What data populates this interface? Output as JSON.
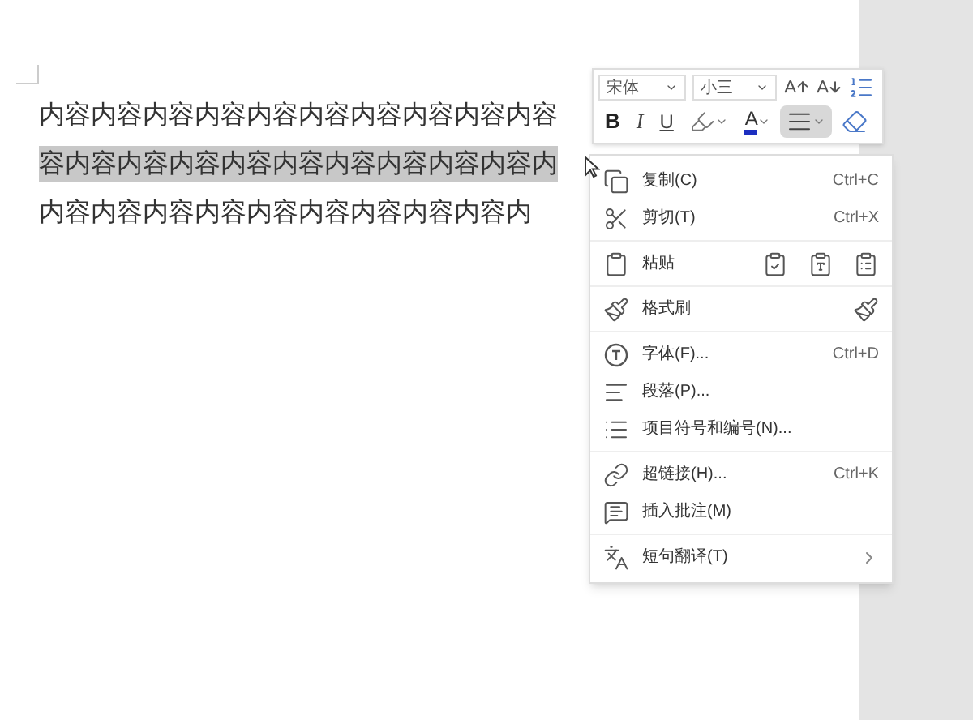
{
  "document": {
    "lines": [
      {
        "text": "内容内容内容内容内容内容内容内容内容内容",
        "selected": false
      },
      {
        "text": "容内容内容内容内容内容内容内容内容内容内",
        "selected": true
      },
      {
        "text": "内容内容内容内容内容内容内容内容内容内",
        "selected": false
      }
    ]
  },
  "toolbar": {
    "font": {
      "value": "宋体"
    },
    "size": {
      "value": "小三"
    },
    "row1": [
      {
        "kind": "grow"
      },
      {
        "kind": "shrink"
      },
      {
        "kind": "spacing"
      }
    ],
    "row2": [
      {
        "kind": "bold",
        "text": "B",
        "selected": false
      },
      {
        "kind": "italic",
        "text": "I",
        "selected": false
      },
      {
        "kind": "underline",
        "text": "U",
        "selected": false
      },
      {
        "kind": "highlight",
        "selected": false
      },
      {
        "kind": "color",
        "text": "A",
        "selected": false
      },
      {
        "kind": "align",
        "selected": true
      },
      {
        "kind": "eraser",
        "selected": false
      }
    ]
  },
  "context_menu": {
    "groups": [
      [
        {
          "kind": "copy",
          "label": "复制(C)",
          "shortcut": "Ctrl+C"
        },
        {
          "kind": "cut",
          "label": "剪切(T)",
          "shortcut": "Ctrl+X"
        }
      ],
      [
        {
          "kind": "paste",
          "label": "粘贴"
        }
      ],
      [
        {
          "kind": "painter",
          "label": "格式刷"
        }
      ],
      [
        {
          "kind": "font",
          "label": "字体(F)...",
          "shortcut": "Ctrl+D"
        },
        {
          "kind": "paragraph",
          "label": "段落(P)..."
        },
        {
          "kind": "bullets",
          "label": "项目符号和编号(N)..."
        }
      ],
      [
        {
          "kind": "link",
          "label": "超链接(H)...",
          "shortcut": "Ctrl+K"
        },
        {
          "kind": "comment",
          "label": "插入批注(M)"
        }
      ],
      [
        {
          "kind": "translate",
          "label": "短句翻译(T)"
        }
      ]
    ]
  }
}
